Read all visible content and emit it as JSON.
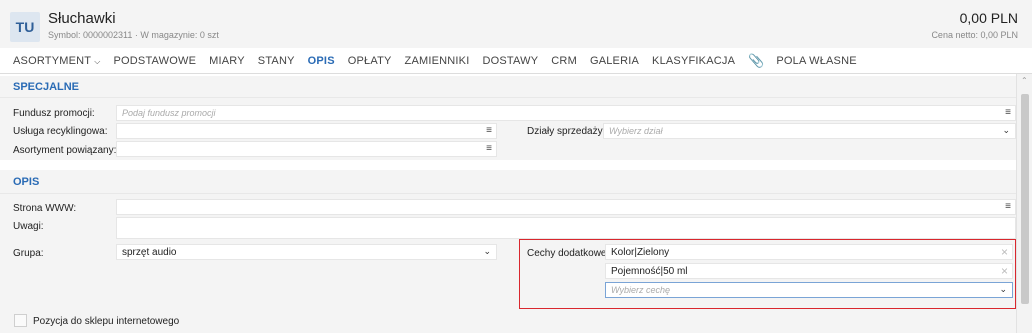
{
  "header": {
    "avatar_initials": "TU",
    "title": "Słuchawki",
    "subtitle": "Symbol: 0000002311  ·  W magazynie: 0 szt",
    "price": "0,00 PLN",
    "net_price": "Cena netto: 0,00 PLN"
  },
  "tabs": [
    {
      "label": "ASORTYMENT"
    },
    {
      "label": "PODSTAWOWE"
    },
    {
      "label": "MIARY"
    },
    {
      "label": "STANY"
    },
    {
      "label": "OPIS"
    },
    {
      "label": "OPŁATY"
    },
    {
      "label": "ZAMIENNIKI"
    },
    {
      "label": "DOSTAWY"
    },
    {
      "label": "CRM"
    },
    {
      "label": "GALERIA"
    },
    {
      "label": "KLASYFIKACJA"
    },
    {
      "label": "POLA WŁASNE"
    }
  ],
  "active_tab": "OPIS",
  "specjalne": {
    "heading": "SPECJALNE",
    "fundusz_label": "Fundusz promocji:",
    "fundusz_placeholder": "Podaj fundusz promocji",
    "usluga_label": "Usługa recyklingowa:",
    "usluga_value": "",
    "dzialy_label": "Działy sprzedaży:",
    "dzialy_placeholder": "Wybierz dział",
    "asortyment_label": "Asortyment powiązany:",
    "asortyment_value": ""
  },
  "opis": {
    "heading": "OPIS",
    "www_label": "Strona WWW:",
    "www_value": "",
    "uwagi_label": "Uwagi:",
    "uwagi_value": "",
    "grupa_label": "Grupa:",
    "grupa_value": "sprzęt audio",
    "cechy_label": "Cechy dodatkowe:",
    "cechy_items": [
      "Kolor|Zielony",
      "Pojemność|50 ml"
    ],
    "cechy_placeholder": "Wybierz cechę",
    "sklep_label": "Pozycja do sklepu internetowego"
  },
  "colors": {
    "accent": "#2a6bb5",
    "highlight": "#d9272e"
  }
}
